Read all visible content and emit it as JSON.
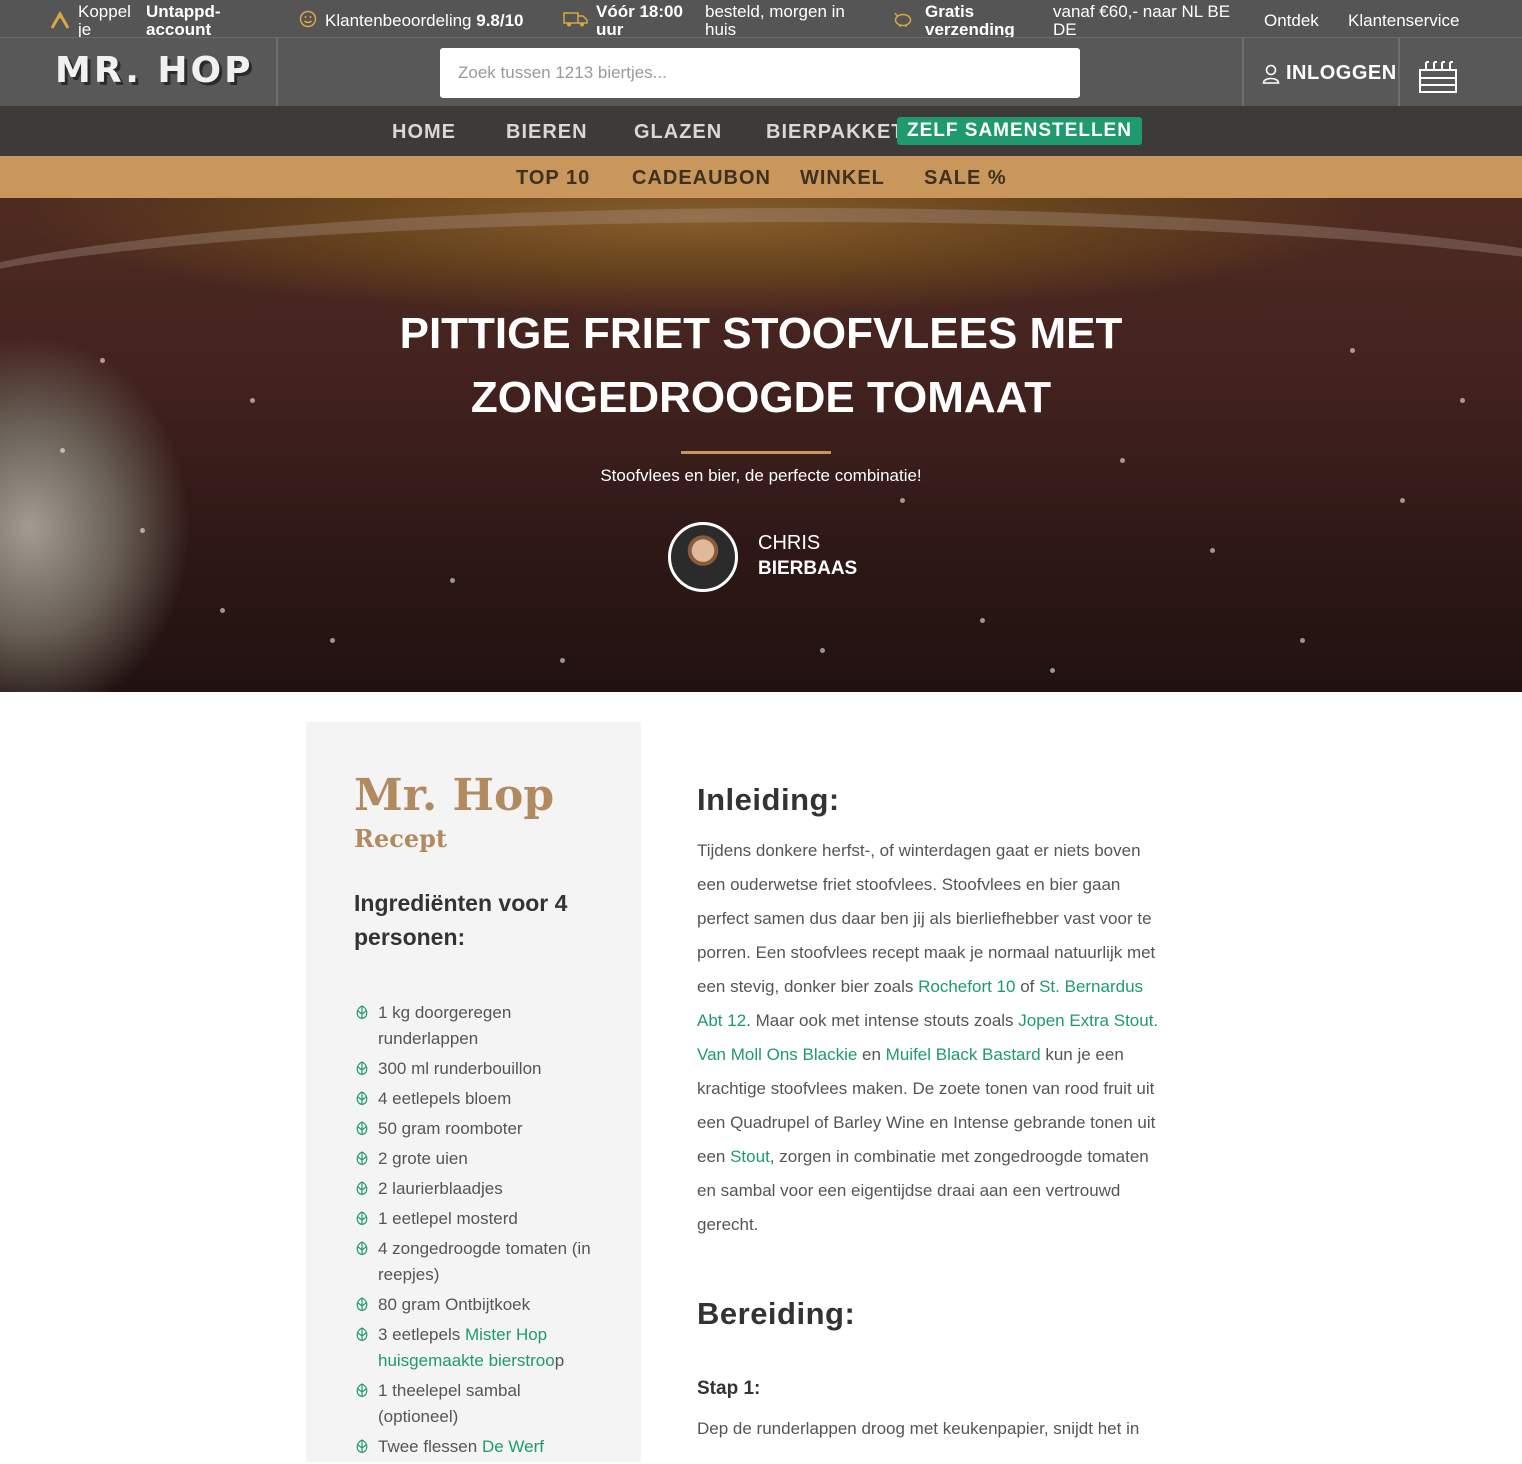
{
  "topbar": {
    "untappd_pre": "Koppel je",
    "untappd_bold": "Untappd-account",
    "rating_label": "Klantenbeoordeling",
    "rating_value": "9.8/10",
    "delivery_bold": "Vóór 18:00 uur",
    "delivery_rest": "besteld, morgen in huis",
    "shipping_bold": "Gratis verzending",
    "shipping_rest": "vanaf €60,- naar NL BE DE",
    "link_discover": "Ontdek",
    "link_service": "Klantenservice"
  },
  "header": {
    "logo": "MR. HOP",
    "search_placeholder": "Zoek tussen 1213 biertjes...",
    "login": "INLOGGEN"
  },
  "nav": {
    "home": "HOME",
    "beers": "BIEREN",
    "glasses": "GLAZEN",
    "package": "BIERPAKKET",
    "compose": "ZELF SAMENSTELLEN"
  },
  "subnav": {
    "top10": "TOP 10",
    "giftcard": "CADEAUBON",
    "shop": "WINKEL",
    "sale": "SALE %"
  },
  "hero": {
    "title": "PITTIGE FRIET STOOFVLEES MET ZONGEDROOGDE TOMAAT",
    "subtitle": "Stoofvlees en bier, de perfecte combinatie!",
    "author_name": "CHRIS",
    "author_role": "BIERBAAS"
  },
  "recipe": {
    "brand": "Mr. Hop",
    "brand_sub": "Recept",
    "ingredients_title": "Ingrediënten voor 4 personen:",
    "ingredients": [
      "1 kg doorgeregen runderlappen",
      "300 ml runderbouillon",
      "4 eetlepels bloem",
      "50 gram roomboter",
      "2 grote uien",
      "2 laurierblaadjes",
      "1 eetlepel mosterd",
      "4 zongedroogde tomaten (in reepjes)",
      "80 gram Ontbijtkoek"
    ],
    "ing_syrup_pre": "3 eetlepels ",
    "ing_syrup_link": "Mister Hop huisgemaakte bierstroo",
    "ing_syrup_post": "p",
    "ing_sambal": "1 theelepel sambal (optioneel)",
    "ing_beer_pre": "Twee flessen ",
    "ing_beer_link": "De Werf"
  },
  "intro": {
    "heading": "Inleiding:",
    "p1": "Tijdens donkere herfst-, of winterdagen gaat er niets boven een ouderwetse friet stoofvlees. Stoofvlees en bier gaan perfect samen dus daar ben jij als bierliefhebber vast voor te porren. Een stoofvlees recept maak je normaal natuurlijk met een stevig, donker bier zoals ",
    "link_rochefort": "Rochefort 10",
    "t_of": " of ",
    "link_bernardus": "St. Bernardus Abt 12",
    "t_stouts": ". Maar ook met intense stouts zoals ",
    "link_jopen": "Jopen Extra Stout",
    "t_dot": ". ",
    "link_vanmoll": "Van Moll Ons Blackie",
    "t_en": " en ",
    "link_muifel": "Muifel Black Bastard",
    "p2": " kun je een krachtige stoofvlees maken. De zoete tonen van rood fruit uit een Quadrupel of Barley Wine en Intense gebrande tonen uit een ",
    "link_stout": "Stout",
    "p3": ", zorgen in combinatie met zongedroogde tomaten en sambal voor een eigentijdse draai aan een vertrouwd gerecht."
  },
  "prep": {
    "heading": "Bereiding:",
    "step1_title": "Stap 1:",
    "step1_text": "Dep de runderlappen droog met keukenpapier, snijdt het in"
  },
  "colors": {
    "accent_green": "#1f9a6d",
    "accent_tan": "#c9975c",
    "brand_brown": "#b28a5f"
  }
}
